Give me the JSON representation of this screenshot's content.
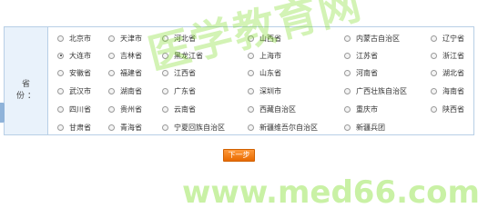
{
  "province_label": "省　份：",
  "rows": [
    [
      "北京市",
      "天津市",
      "河北省",
      "山西省",
      "内蒙古自治区",
      "辽宁省"
    ],
    [
      "大连市",
      "吉林省",
      "黑龙江省",
      "上海市",
      "江苏省",
      "浙江省"
    ],
    [
      "安徽省",
      "福建省",
      "江西省",
      "山东省",
      "河南省",
      "湖北省"
    ],
    [
      "武汉市",
      "湖南省",
      "广东省",
      "深圳市",
      "广西壮族自治区",
      "海南省"
    ],
    [
      "四川省",
      "贵州省",
      "云南省",
      "西藏自治区",
      "重庆市",
      "陕西省"
    ],
    [
      "甘肃省",
      "青海省",
      "宁夏回族自治区",
      "新疆维吾尔自治区",
      "新疆兵团",
      ""
    ]
  ],
  "selected": "大连市",
  "next_button": "下一步",
  "watermark": {
    "chinese": "医学教育网",
    "url": "www.med66.com"
  },
  "colors": {
    "panel_border": "#b8cfe6",
    "panel_bg": "#e9f2fb",
    "button_orange": "#f07a10",
    "watermark_green": "#78dc1e"
  }
}
